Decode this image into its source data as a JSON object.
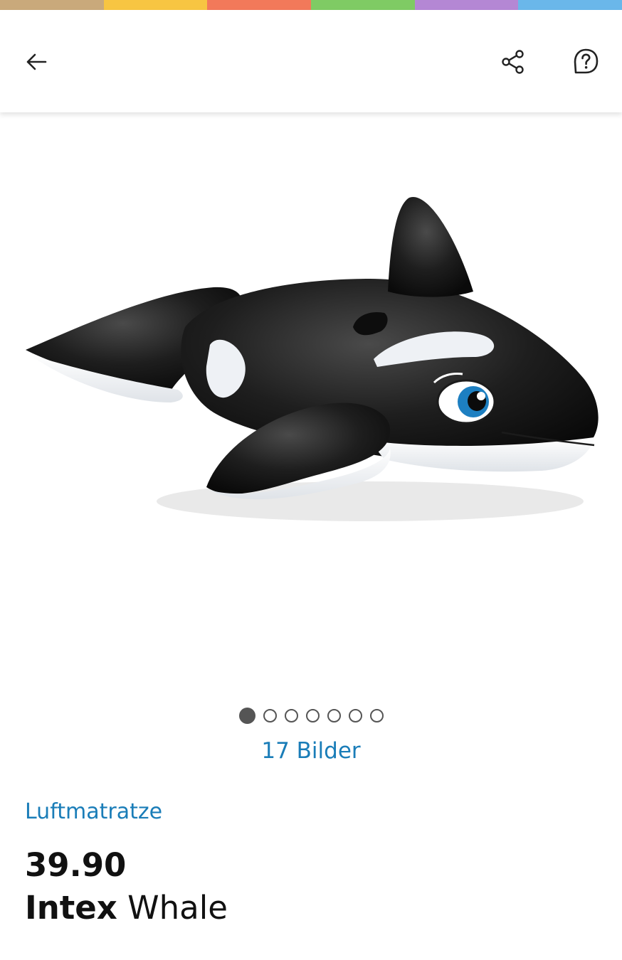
{
  "brand_stripe_colors": [
    "#c9a97b",
    "#f7c542",
    "#f2795a",
    "#7fcb64",
    "#b487d4",
    "#6ab7ea"
  ],
  "header": {
    "back_icon": "arrow-left-icon",
    "share_icon": "share-icon",
    "help_icon": "help-question-icon"
  },
  "gallery": {
    "image_subject": "inflatable orca whale",
    "total_dots": 7,
    "active_index": 0,
    "image_count_label": "17 Bilder"
  },
  "product": {
    "category": "Luftmatratze",
    "price": "39.90",
    "brand": "Intex",
    "name": "Whale"
  },
  "colors": {
    "link": "#1a7db8",
    "text": "#111111"
  }
}
